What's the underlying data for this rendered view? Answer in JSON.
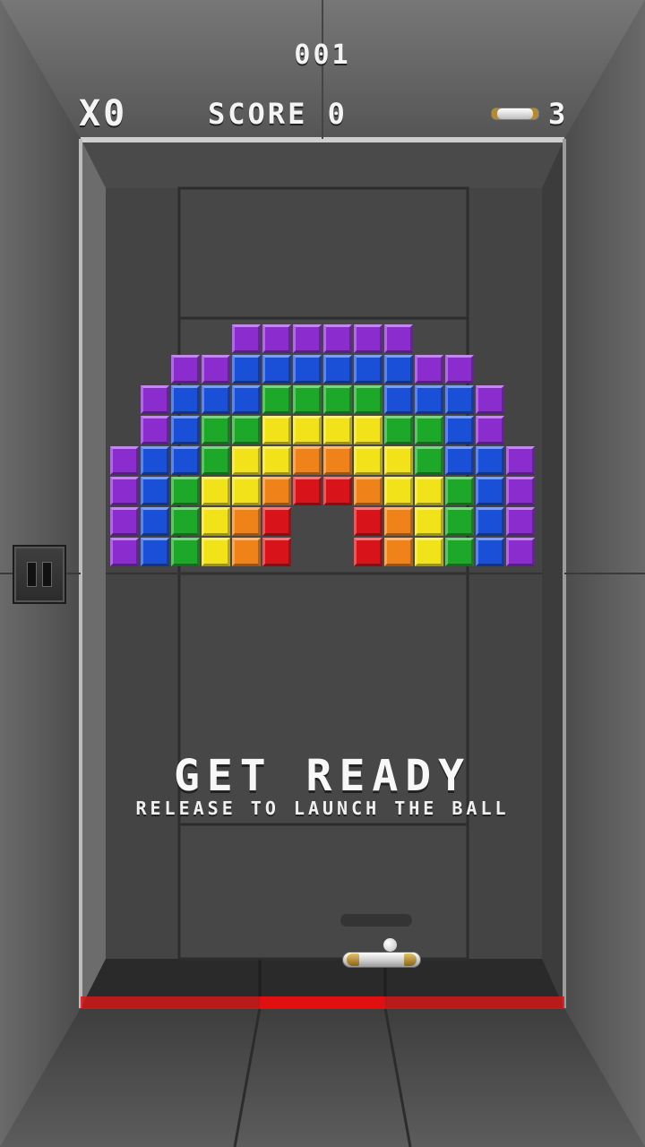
{
  "hud": {
    "level": "001",
    "multiplier": "X0",
    "score_label": "SCORE 0",
    "lives": "3"
  },
  "message": {
    "title": "GET READY",
    "subtitle": "RELEASE TO LAUNCH THE BALL"
  },
  "colors": {
    "purple": "#8b2ccf",
    "blue": "#1a4fd8",
    "green": "#1ea82a",
    "yellow": "#f2e21a",
    "orange": "#f0821a",
    "red": "#d8141a",
    "danger_line": "#d21818"
  },
  "bricks": {
    "start_col": -1,
    "rows": [
      "...PPPPPP...",
      ".PPBBBBBBPP.",
      "PBBBGGGGBBBP",
      "PBGGYYYYGGBP",
      "PBBGYYOOYYGBBP",
      "PBGYYORROYYGBP",
      "PBGYOR..RO YGBP",
      "PBGYOR..ROYGBP"
    ]
  },
  "icons": {
    "pause": "pause-icon",
    "lives": "paddle-icon"
  }
}
